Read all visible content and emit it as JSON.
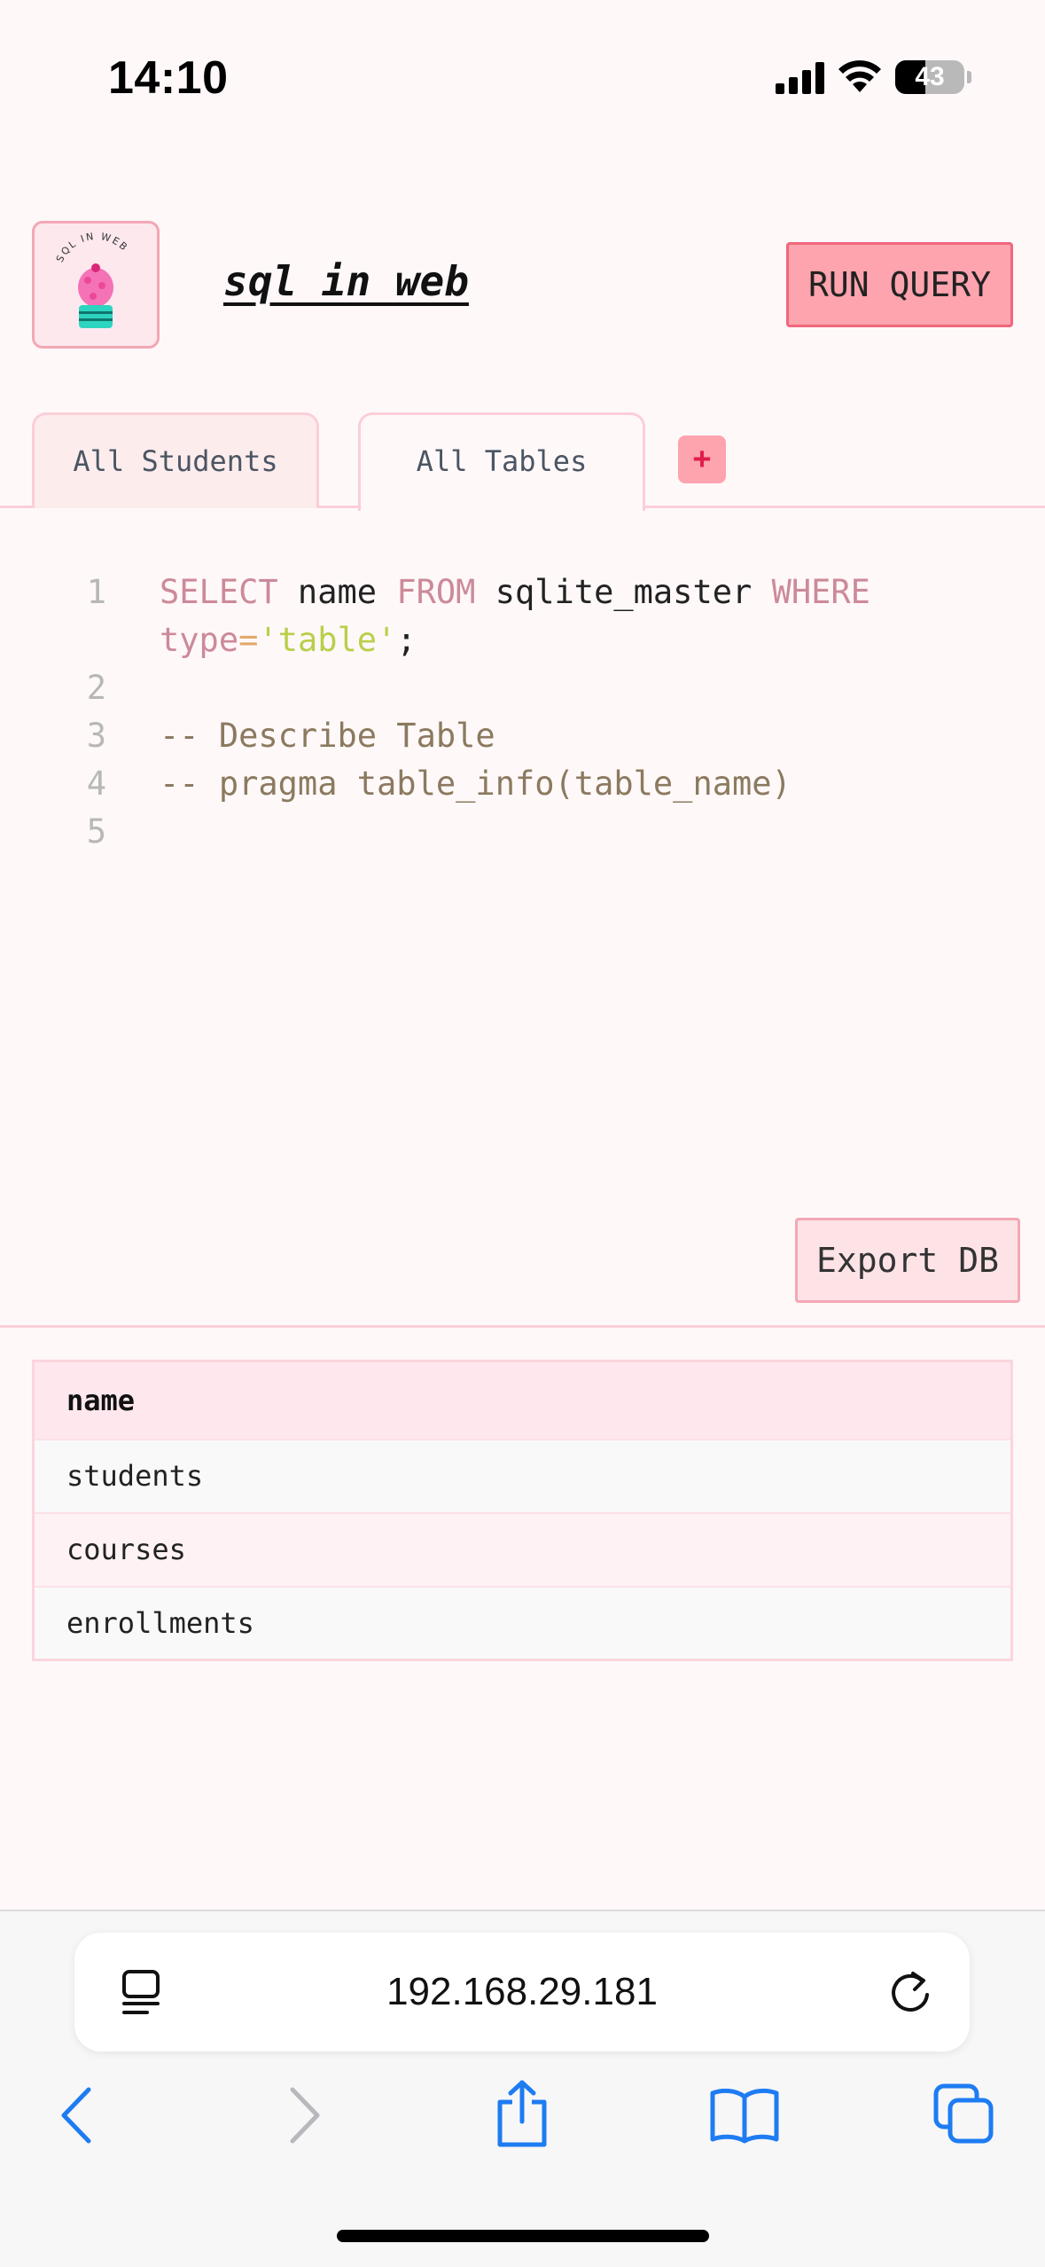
{
  "status": {
    "time": "14:10",
    "battery_percent": 43
  },
  "header": {
    "title": "sql in web",
    "logo_text": "SQL IN WEB",
    "run_label": "RUN QUERY"
  },
  "tabs": [
    {
      "label": "All Students",
      "active": false
    },
    {
      "label": "All Tables",
      "active": true
    }
  ],
  "add_tab_label": "+",
  "editor": {
    "lines": [
      {
        "n": "1",
        "tokens": [
          {
            "t": "SELECT",
            "c": "kw"
          },
          {
            "t": " name ",
            "c": "plain"
          },
          {
            "t": "FROM",
            "c": "kw"
          },
          {
            "t": " sqlite_master ",
            "c": "plain"
          },
          {
            "t": "WHERE",
            "c": "kw"
          }
        ]
      },
      {
        "n": "",
        "tokens": [
          {
            "t": "type",
            "c": "kw"
          },
          {
            "t": "=",
            "c": "op"
          },
          {
            "t": "'table'",
            "c": "str"
          },
          {
            "t": ";",
            "c": "plain"
          }
        ]
      },
      {
        "n": "2",
        "tokens": []
      },
      {
        "n": "3",
        "tokens": [
          {
            "t": "-- Describe Table",
            "c": "cmt"
          }
        ]
      },
      {
        "n": "4",
        "tokens": [
          {
            "t": "-- pragma table_info(table_name)",
            "c": "cmt"
          }
        ]
      },
      {
        "n": "5",
        "tokens": []
      }
    ]
  },
  "export_label": "Export DB",
  "results": {
    "columns": [
      "name"
    ],
    "rows": [
      [
        "students"
      ],
      [
        "courses"
      ],
      [
        "enrollments"
      ]
    ]
  },
  "browser": {
    "url": "192.168.29.181"
  },
  "colors": {
    "accent": "#fda4af",
    "border": "#fbcfd8",
    "background": "#fff8f9"
  }
}
